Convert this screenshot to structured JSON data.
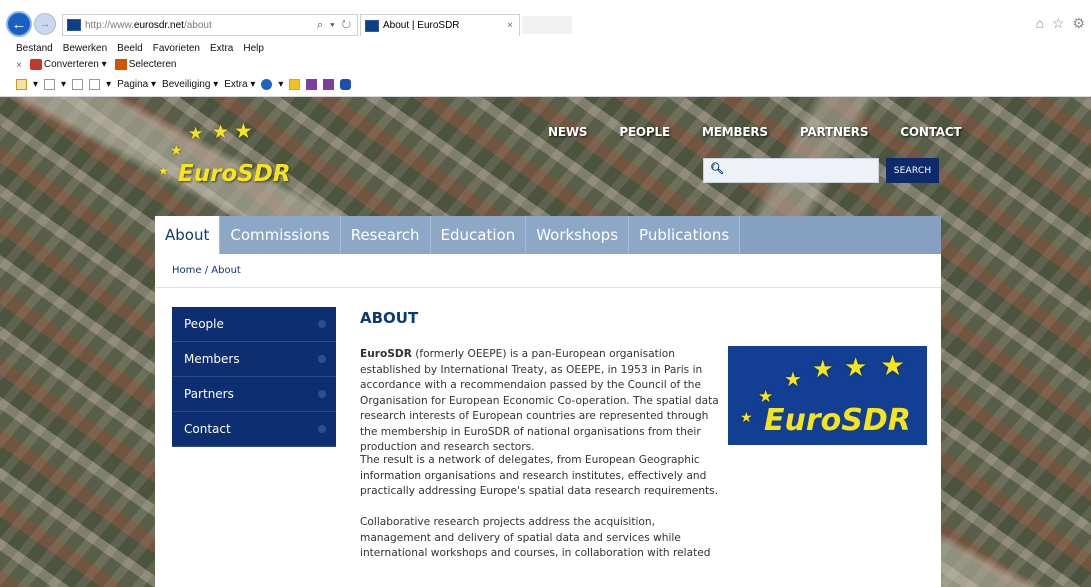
{
  "browser": {
    "url_prefix": "http://www.",
    "url_domain": "eurosdr.net",
    "url_suffix": "/about",
    "url_tools": "⌕ ▾ ↻",
    "tab_title": "About | EuroSDR",
    "tab_close": "×",
    "back_glyph": "←",
    "forward_glyph": "→",
    "right_icons": "⌂ ☆ ⚙"
  },
  "menu": [
    "Bestand",
    "Bewerken",
    "Beeld",
    "Favorieten",
    "Extra",
    "Help"
  ],
  "convert_bar": {
    "close": "×",
    "convert": "Converteren",
    "select": "Selecteren"
  },
  "command_bar": {
    "page": "Pagina",
    "security": "Beveiliging",
    "extra": "Extra"
  },
  "site": {
    "logo_text": "EuroSDR",
    "top_nav": [
      "NEWS",
      "PEOPLE",
      "MEMBERS",
      "PARTNERS",
      "CONTACT"
    ],
    "search": {
      "icon": "search-icon",
      "value": "",
      "button": "SEARCH"
    },
    "main_nav": [
      "About",
      "Commissions",
      "Research",
      "Education",
      "Workshops",
      "Publications"
    ],
    "breadcrumb": "Home / About",
    "sidebar": [
      "People",
      "Members",
      "Partners",
      "Contact"
    ],
    "about": {
      "title": "ABOUT",
      "p1_strong": "EuroSDR",
      "p1_rest": " (formerly OEEPE) is a pan-European organisation established by International Treaty, as OEEPE, in 1953 in Paris in accordance with a recommendaion passed by the Council of the Organisation for European Economic Co-operation. The spatial data research interests of European countries are represented through the membership in EuroSDR of national organisations from their production and research sectors.",
      "p2": "The result is a network of delegates, from European Geographic information organisations and research institutes, effectively and practically addressing Europe's spatial data research requirements.",
      "p3": "Collaborative research projects address the acquisition, management and delivery of spatial data and services while international workshops and courses, in collaboration with related"
    }
  },
  "colors": {
    "navy": "#0d2f72",
    "logo_blue": "#123e93",
    "star_yellow": "#f6e51a",
    "nav_blue": "#8da7c6"
  }
}
